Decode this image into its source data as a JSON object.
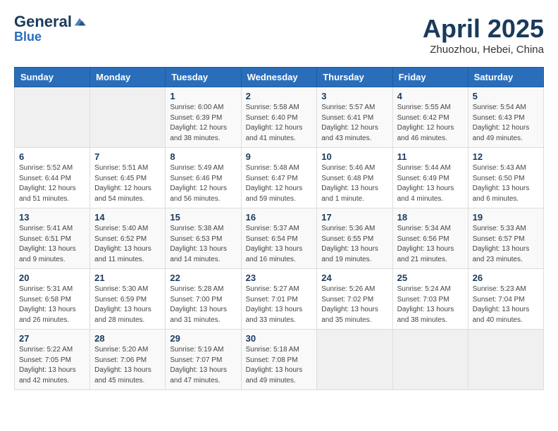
{
  "header": {
    "logo_general": "General",
    "logo_blue": "Blue",
    "month_title": "April 2025",
    "location": "Zhuozhou, Hebei, China"
  },
  "weekdays": [
    "Sunday",
    "Monday",
    "Tuesday",
    "Wednesday",
    "Thursday",
    "Friday",
    "Saturday"
  ],
  "weeks": [
    [
      {
        "day": "",
        "info": ""
      },
      {
        "day": "",
        "info": ""
      },
      {
        "day": "1",
        "info": "Sunrise: 6:00 AM\nSunset: 6:39 PM\nDaylight: 12 hours and 38 minutes."
      },
      {
        "day": "2",
        "info": "Sunrise: 5:58 AM\nSunset: 6:40 PM\nDaylight: 12 hours and 41 minutes."
      },
      {
        "day": "3",
        "info": "Sunrise: 5:57 AM\nSunset: 6:41 PM\nDaylight: 12 hours and 43 minutes."
      },
      {
        "day": "4",
        "info": "Sunrise: 5:55 AM\nSunset: 6:42 PM\nDaylight: 12 hours and 46 minutes."
      },
      {
        "day": "5",
        "info": "Sunrise: 5:54 AM\nSunset: 6:43 PM\nDaylight: 12 hours and 49 minutes."
      }
    ],
    [
      {
        "day": "6",
        "info": "Sunrise: 5:52 AM\nSunset: 6:44 PM\nDaylight: 12 hours and 51 minutes."
      },
      {
        "day": "7",
        "info": "Sunrise: 5:51 AM\nSunset: 6:45 PM\nDaylight: 12 hours and 54 minutes."
      },
      {
        "day": "8",
        "info": "Sunrise: 5:49 AM\nSunset: 6:46 PM\nDaylight: 12 hours and 56 minutes."
      },
      {
        "day": "9",
        "info": "Sunrise: 5:48 AM\nSunset: 6:47 PM\nDaylight: 12 hours and 59 minutes."
      },
      {
        "day": "10",
        "info": "Sunrise: 5:46 AM\nSunset: 6:48 PM\nDaylight: 13 hours and 1 minute."
      },
      {
        "day": "11",
        "info": "Sunrise: 5:44 AM\nSunset: 6:49 PM\nDaylight: 13 hours and 4 minutes."
      },
      {
        "day": "12",
        "info": "Sunrise: 5:43 AM\nSunset: 6:50 PM\nDaylight: 13 hours and 6 minutes."
      }
    ],
    [
      {
        "day": "13",
        "info": "Sunrise: 5:41 AM\nSunset: 6:51 PM\nDaylight: 13 hours and 9 minutes."
      },
      {
        "day": "14",
        "info": "Sunrise: 5:40 AM\nSunset: 6:52 PM\nDaylight: 13 hours and 11 minutes."
      },
      {
        "day": "15",
        "info": "Sunrise: 5:38 AM\nSunset: 6:53 PM\nDaylight: 13 hours and 14 minutes."
      },
      {
        "day": "16",
        "info": "Sunrise: 5:37 AM\nSunset: 6:54 PM\nDaylight: 13 hours and 16 minutes."
      },
      {
        "day": "17",
        "info": "Sunrise: 5:36 AM\nSunset: 6:55 PM\nDaylight: 13 hours and 19 minutes."
      },
      {
        "day": "18",
        "info": "Sunrise: 5:34 AM\nSunset: 6:56 PM\nDaylight: 13 hours and 21 minutes."
      },
      {
        "day": "19",
        "info": "Sunrise: 5:33 AM\nSunset: 6:57 PM\nDaylight: 13 hours and 23 minutes."
      }
    ],
    [
      {
        "day": "20",
        "info": "Sunrise: 5:31 AM\nSunset: 6:58 PM\nDaylight: 13 hours and 26 minutes."
      },
      {
        "day": "21",
        "info": "Sunrise: 5:30 AM\nSunset: 6:59 PM\nDaylight: 13 hours and 28 minutes."
      },
      {
        "day": "22",
        "info": "Sunrise: 5:28 AM\nSunset: 7:00 PM\nDaylight: 13 hours and 31 minutes."
      },
      {
        "day": "23",
        "info": "Sunrise: 5:27 AM\nSunset: 7:01 PM\nDaylight: 13 hours and 33 minutes."
      },
      {
        "day": "24",
        "info": "Sunrise: 5:26 AM\nSunset: 7:02 PM\nDaylight: 13 hours and 35 minutes."
      },
      {
        "day": "25",
        "info": "Sunrise: 5:24 AM\nSunset: 7:03 PM\nDaylight: 13 hours and 38 minutes."
      },
      {
        "day": "26",
        "info": "Sunrise: 5:23 AM\nSunset: 7:04 PM\nDaylight: 13 hours and 40 minutes."
      }
    ],
    [
      {
        "day": "27",
        "info": "Sunrise: 5:22 AM\nSunset: 7:05 PM\nDaylight: 13 hours and 42 minutes."
      },
      {
        "day": "28",
        "info": "Sunrise: 5:20 AM\nSunset: 7:06 PM\nDaylight: 13 hours and 45 minutes."
      },
      {
        "day": "29",
        "info": "Sunrise: 5:19 AM\nSunset: 7:07 PM\nDaylight: 13 hours and 47 minutes."
      },
      {
        "day": "30",
        "info": "Sunrise: 5:18 AM\nSunset: 7:08 PM\nDaylight: 13 hours and 49 minutes."
      },
      {
        "day": "",
        "info": ""
      },
      {
        "day": "",
        "info": ""
      },
      {
        "day": "",
        "info": ""
      }
    ]
  ]
}
